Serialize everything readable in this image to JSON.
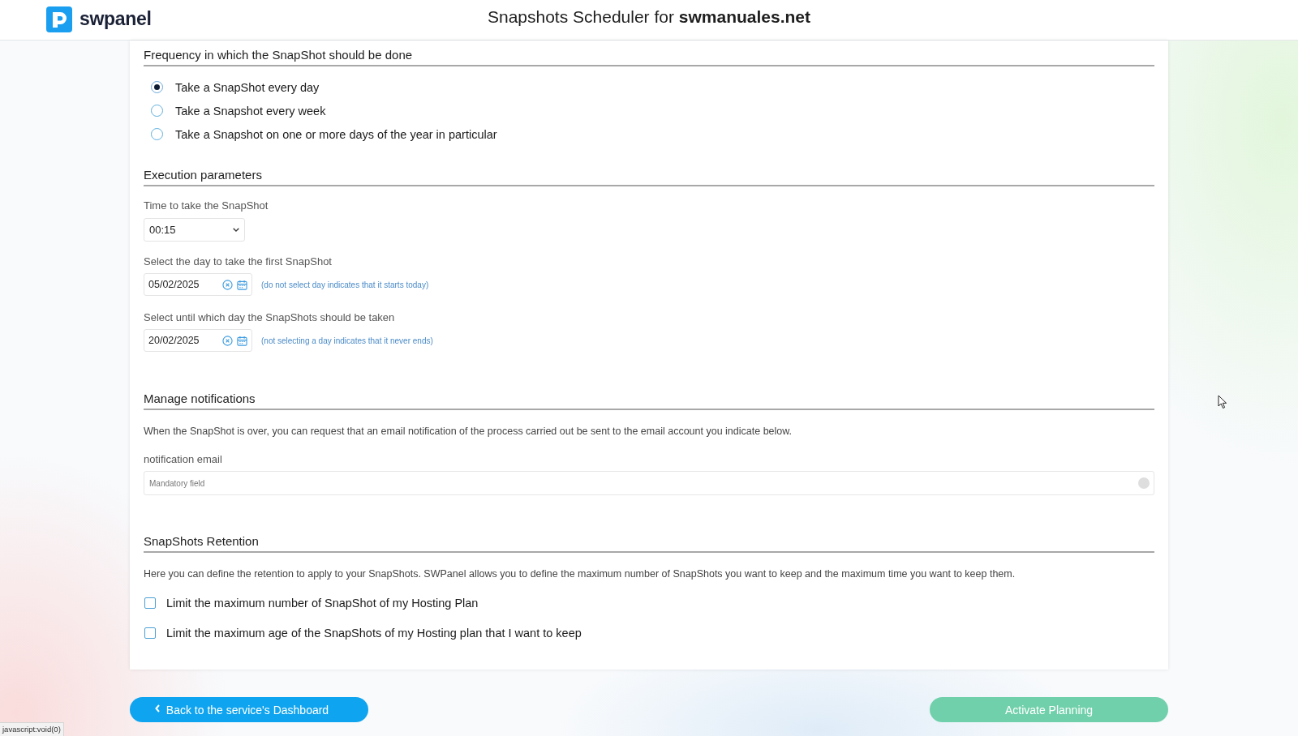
{
  "header": {
    "logo_text": "swpanel",
    "title": "Snapshots Scheduler for **swmanuales.net**"
  },
  "frequency": {
    "heading": "Frequency in which the SnapShot should be done",
    "options": [
      {
        "label": "Take a SnapShot every day",
        "selected": true
      },
      {
        "label": "Take a Snapshot every week",
        "selected": false
      },
      {
        "label": "Take a Snapshot on one or more days of the year in particular",
        "selected": false
      }
    ]
  },
  "execution": {
    "heading": "Execution parameters",
    "time": {
      "label": "Time to take the SnapShot",
      "value": "00:15"
    },
    "dates": [
      {
        "label": "Select the day to take the first SnapShot",
        "value": "05/02/2025",
        "hint": "(do not select day indicates that it starts today)"
      },
      {
        "label": "Select until which day the SnapShots should be taken",
        "value": "20/02/2025",
        "hint": "(not selecting a day indicates that it never ends)"
      }
    ]
  },
  "notifications": {
    "heading": "Manage notifications",
    "description": "When the SnapShot is over, you can request that an email notification of the process carried out be sent to the email account you indicate below.",
    "email": {
      "label": "notification email",
      "placeholder": "Mandatory field"
    }
  },
  "retention": {
    "heading": "SnapShots Retention",
    "description": "Here you can define the retention to apply to your SnapShots. SWPanel allows you to define the maximum number of SnapShots you want to keep and the maximum time you want to keep them.",
    "options": [
      {
        "label": "Limit the maximum number of SnapShot of my Hosting Plan",
        "checked": false
      },
      {
        "label": "Limit the maximum age of the SnapShots of my Hosting plan that I want to keep",
        "checked": false
      }
    ]
  },
  "buttons": [
    {
      "label": "Back to the service's Dashboard",
      "kind": "back"
    },
    {
      "label": "Activate Planning",
      "kind": "submit"
    }
  ],
  "status_bar": "javascript:void(0)"
}
